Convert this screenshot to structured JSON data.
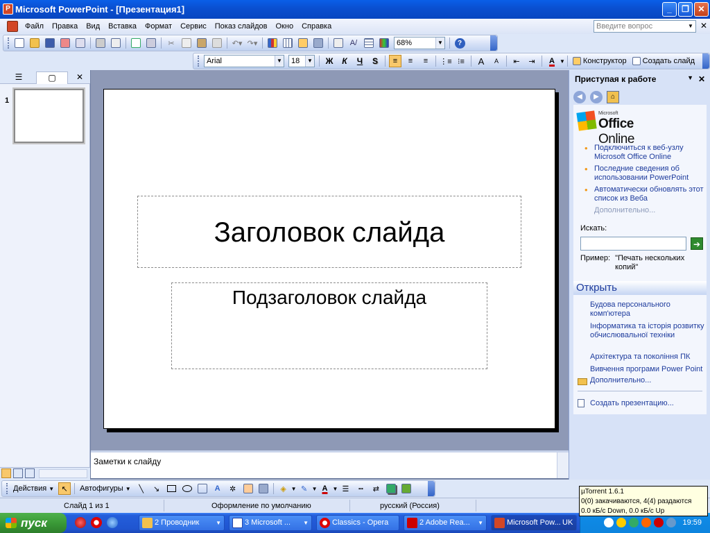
{
  "window": {
    "title": "Microsoft PowerPoint - [Презентация1]",
    "buttons": {
      "minimize": "_",
      "restore": "❐",
      "close": "✕"
    }
  },
  "menu": {
    "items": [
      "Файл",
      "Правка",
      "Вид",
      "Вставка",
      "Формат",
      "Сервис",
      "Показ слайдов",
      "Окно",
      "Справка"
    ],
    "help_placeholder": "Введите вопрос",
    "close": "✕"
  },
  "standard_toolbar": {
    "zoom": "68%",
    "help_icon": "?"
  },
  "format_toolbar": {
    "font": "Arial",
    "size": "18",
    "bold": "Ж",
    "italic": "К",
    "underline": "Ч",
    "shadow": "S",
    "designer": "Конструктор",
    "new_slide": "Создать слайд",
    "font_grow": "A",
    "font_shrink": "A",
    "font_color": "A"
  },
  "left_panel": {
    "tab_outline": "☰",
    "tab_slides": "▢",
    "close": "✕",
    "slide_number": "1"
  },
  "slide": {
    "title": "Заголовок слайда",
    "subtitle": "Подзаголовок слайда"
  },
  "notes": {
    "placeholder": "Заметки к слайду"
  },
  "task_pane": {
    "title": "Приступая к работе",
    "dropdown": "▼",
    "close": "✕",
    "nav": {
      "back": "◀",
      "forward": "▶",
      "home": "⌂"
    },
    "logo": {
      "small": "Microsoft",
      "main": "Office",
      "suffix": " Online"
    },
    "links": [
      "Подключиться к веб-узлу Microsoft Office Online",
      "Последние сведения об использовании PowerPoint",
      "Автоматически обновлять этот список из Веба"
    ],
    "more_disabled": "Дополнительно...",
    "search_label": "Искать:",
    "search_value": "",
    "go": "➔",
    "example_label": "Пример:",
    "example_value": "\"Печать нескольких копий\"",
    "open_header": "Открыть",
    "open_files": [
      "Будова персонального комп'ютера",
      "Інформатика та історія розвитку обчислювальної техніки",
      "Архітектура та покоління ПК",
      "Вивчення програми Power Point"
    ],
    "more": "Дополнительно...",
    "create": "Создать презентацию..."
  },
  "drawing_toolbar": {
    "actions": "Действия",
    "autoshapes": "Автофигуры",
    "font_color": "A"
  },
  "status": {
    "slide": "Слайд 1 из 1",
    "design": "Оформление по умолчанию",
    "language": "русский (Россия)"
  },
  "utorrent": {
    "line1": "µTorrent 1.6.1",
    "line2": "0(0) закачиваются, 4(4) раздаются",
    "line3": "0.0 кБ/с Down, 0.0 кБ/с Up"
  },
  "taskbar": {
    "start": "пуск",
    "tasks": [
      "2 Проводник",
      "3 Microsoft ...",
      "Classics - Opera",
      "2 Adobe Rea...",
      "Microsoft Pow..."
    ],
    "lang": "UK",
    "clock": "19:59"
  }
}
